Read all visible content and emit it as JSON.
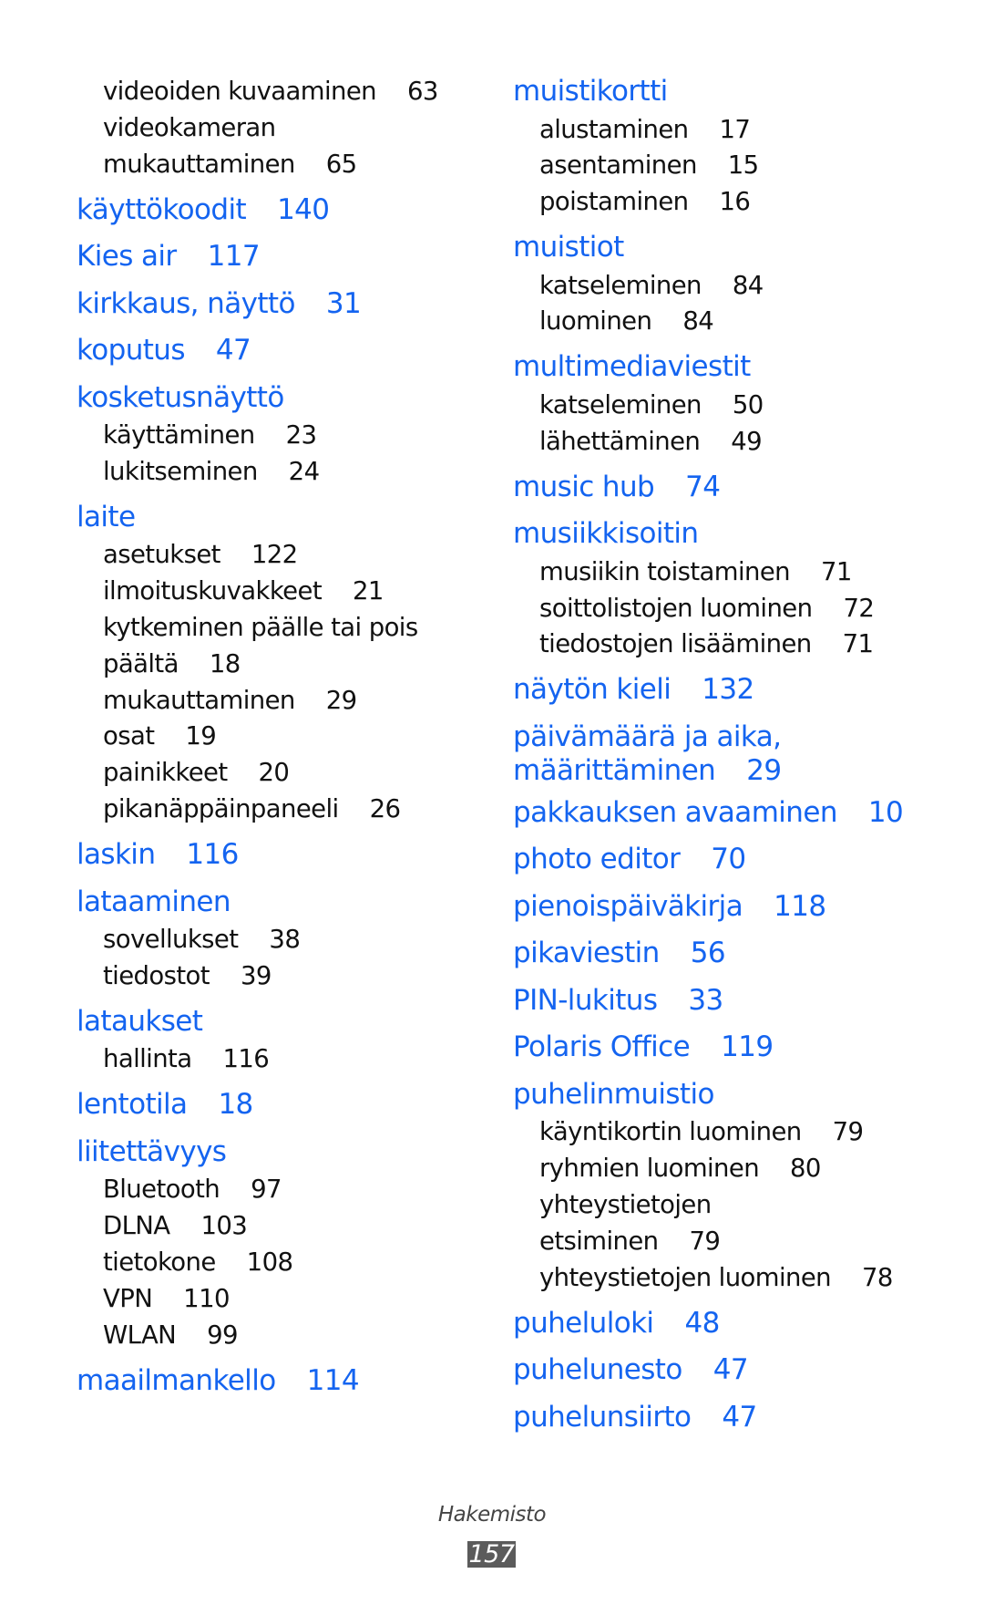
{
  "columns": [
    {
      "entries": [
        {
          "type": "sub",
          "text": "videoiden kuvaaminen",
          "page": "63"
        },
        {
          "type": "sub",
          "text": "videokameran",
          "page": ""
        },
        {
          "type": "sub",
          "text": "mukauttaminen",
          "page": "65"
        },
        {
          "type": "heading",
          "text": "käyttökoodit",
          "page": "140"
        },
        {
          "type": "heading",
          "text": "Kies air",
          "page": "117"
        },
        {
          "type": "heading",
          "text": "kirkkaus, näyttö",
          "page": "31"
        },
        {
          "type": "heading",
          "text": "koputus",
          "page": "47"
        },
        {
          "type": "heading",
          "text": "kosketusnäyttö",
          "page": ""
        },
        {
          "type": "sub",
          "text": "käyttäminen",
          "page": "23"
        },
        {
          "type": "sub",
          "text": "lukitseminen",
          "page": "24"
        },
        {
          "type": "heading",
          "text": "laite",
          "page": ""
        },
        {
          "type": "sub",
          "text": "asetukset",
          "page": "122"
        },
        {
          "type": "sub",
          "text": "ilmoituskuvakkeet",
          "page": "21"
        },
        {
          "type": "sub",
          "text": "kytkeminen päälle tai pois",
          "page": ""
        },
        {
          "type": "sub",
          "text": "päältä",
          "page": "18"
        },
        {
          "type": "sub",
          "text": "mukauttaminen",
          "page": "29"
        },
        {
          "type": "sub",
          "text": "osat",
          "page": "19"
        },
        {
          "type": "sub",
          "text": "painikkeet",
          "page": "20"
        },
        {
          "type": "sub",
          "text": "pikanäppäinpaneeli",
          "page": "26"
        },
        {
          "type": "heading",
          "text": "laskin",
          "page": "116"
        },
        {
          "type": "heading",
          "text": "lataaminen",
          "page": ""
        },
        {
          "type": "sub",
          "text": "sovellukset",
          "page": "38"
        },
        {
          "type": "sub",
          "text": "tiedostot",
          "page": "39"
        },
        {
          "type": "heading",
          "text": "lataukset",
          "page": ""
        },
        {
          "type": "sub",
          "text": "hallinta",
          "page": "116"
        },
        {
          "type": "heading",
          "text": "lentotila",
          "page": "18"
        },
        {
          "type": "heading",
          "text": "liitettävyys",
          "page": ""
        },
        {
          "type": "sub",
          "text": "Bluetooth",
          "page": "97"
        },
        {
          "type": "sub",
          "text": "DLNA",
          "page": "103"
        },
        {
          "type": "sub",
          "text": "tietokone",
          "page": "108"
        },
        {
          "type": "sub",
          "text": "VPN",
          "page": "110"
        },
        {
          "type": "sub",
          "text": "WLAN",
          "page": "99"
        },
        {
          "type": "heading",
          "text": "maailmankello",
          "page": "114"
        }
      ]
    },
    {
      "entries": [
        {
          "type": "heading",
          "text": "muistikortti",
          "page": ""
        },
        {
          "type": "sub",
          "text": "alustaminen",
          "page": "17"
        },
        {
          "type": "sub",
          "text": "asentaminen",
          "page": "15"
        },
        {
          "type": "sub",
          "text": "poistaminen",
          "page": "16"
        },
        {
          "type": "heading",
          "text": "muistiot",
          "page": ""
        },
        {
          "type": "sub",
          "text": "katseleminen",
          "page": "84"
        },
        {
          "type": "sub",
          "text": "luominen",
          "page": "84"
        },
        {
          "type": "heading",
          "text": "multimediaviestit",
          "page": ""
        },
        {
          "type": "sub",
          "text": "katseleminen",
          "page": "50"
        },
        {
          "type": "sub",
          "text": "lähettäminen",
          "page": "49"
        },
        {
          "type": "heading",
          "text": "music hub",
          "page": "74"
        },
        {
          "type": "heading",
          "text": "musiikkisoitin",
          "page": ""
        },
        {
          "type": "sub",
          "text": "musiikin toistaminen",
          "page": "71"
        },
        {
          "type": "sub",
          "text": "soittolistojen luominen",
          "page": "72"
        },
        {
          "type": "sub",
          "text": "tiedostojen lisääminen",
          "page": "71"
        },
        {
          "type": "heading",
          "text": "näytön kieli",
          "page": "132"
        },
        {
          "type": "heading",
          "text": "päivämäärä ja aika,",
          "page": ""
        },
        {
          "type": "heading-cont",
          "text": "määrittäminen",
          "page": "29"
        },
        {
          "type": "heading",
          "text": "pakkauksen avaaminen",
          "page": "10"
        },
        {
          "type": "heading",
          "text": "photo editor",
          "page": "70"
        },
        {
          "type": "heading",
          "text": "pienoispäiväkirja",
          "page": "118"
        },
        {
          "type": "heading",
          "text": "pikaviestin",
          "page": "56"
        },
        {
          "type": "heading",
          "text": "PIN-lukitus",
          "page": "33"
        },
        {
          "type": "heading",
          "text": "Polaris Office",
          "page": "119"
        },
        {
          "type": "heading",
          "text": "puhelinmuistio",
          "page": ""
        },
        {
          "type": "sub",
          "text": "käyntikortin luominen",
          "page": "79"
        },
        {
          "type": "sub",
          "text": "ryhmien luominen",
          "page": "80"
        },
        {
          "type": "sub",
          "text": "yhteystietojen",
          "page": ""
        },
        {
          "type": "sub",
          "text": "etsiminen",
          "page": "79"
        },
        {
          "type": "sub",
          "text": "yhteystietojen luominen",
          "page": "78"
        },
        {
          "type": "heading",
          "text": "puheluloki",
          "page": "48"
        },
        {
          "type": "heading",
          "text": "puhelunesto",
          "page": "47"
        },
        {
          "type": "heading",
          "text": "puhelunsiirto",
          "page": "47"
        }
      ]
    }
  ],
  "footer": {
    "section_title": "Hakemisto",
    "page_number": "157"
  },
  "colors": {
    "heading": "#1464f0",
    "subentry": "#111111",
    "page_number_box": "#5b5b5b"
  }
}
